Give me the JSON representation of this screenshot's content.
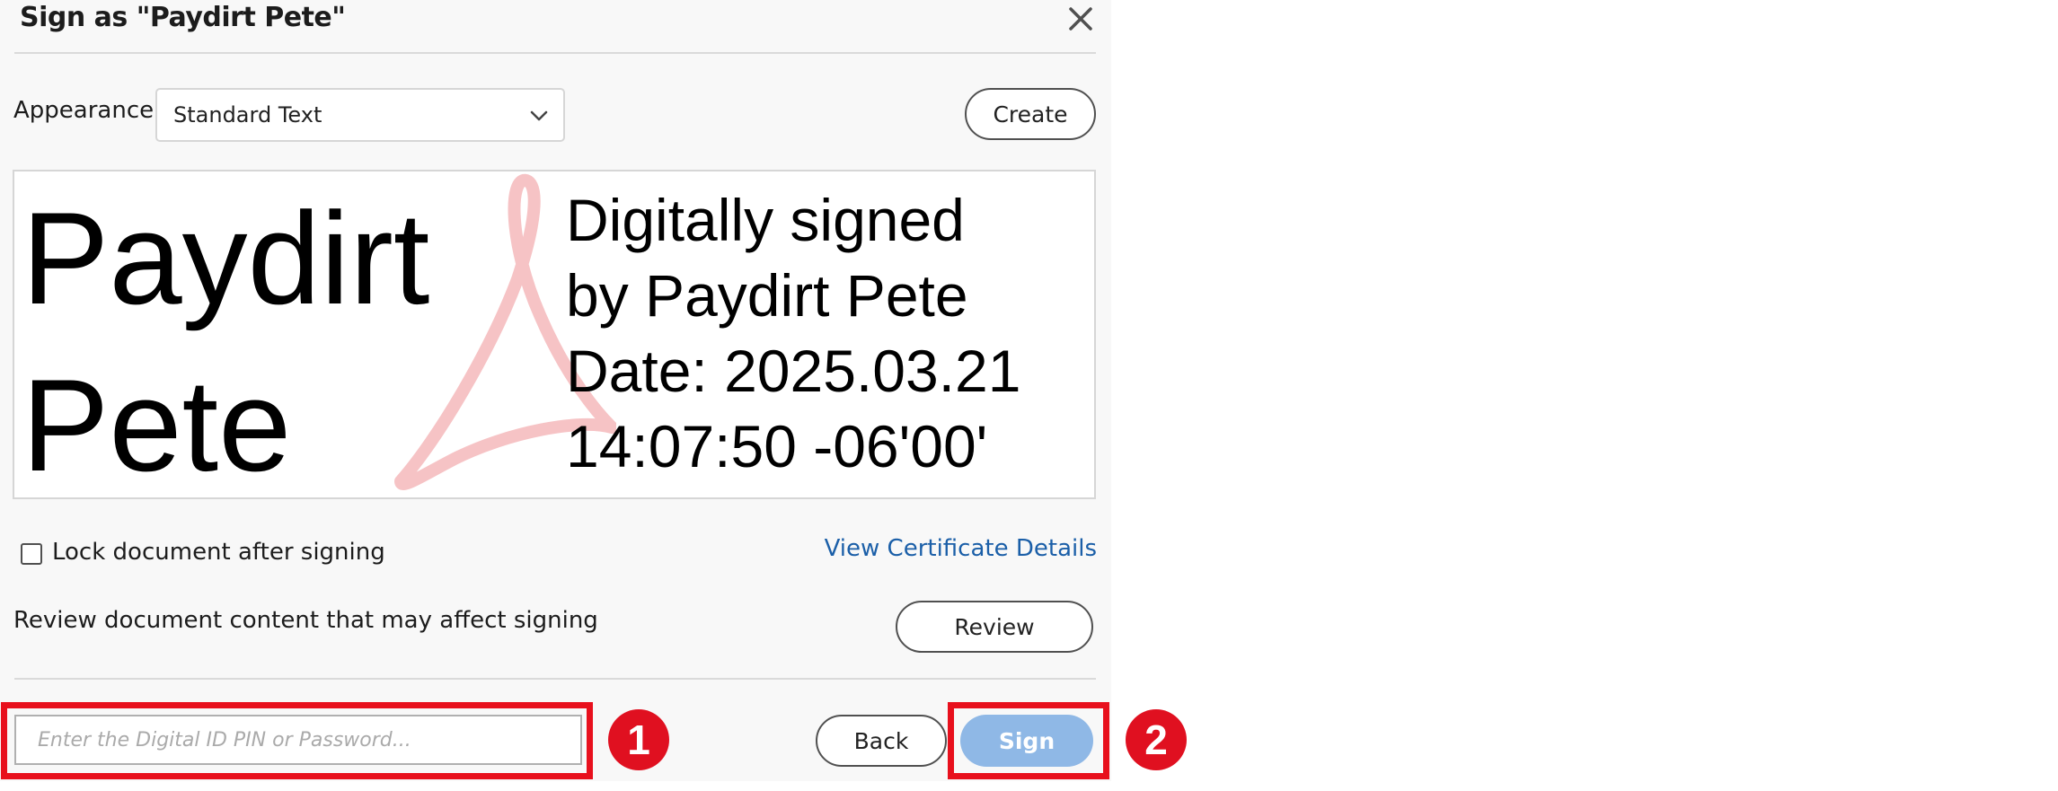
{
  "dialog": {
    "title": "Sign as \"Paydirt Pete\"",
    "close_icon": "close-icon"
  },
  "appearance": {
    "label": "Appearance",
    "selected": "Standard Text",
    "create_label": "Create"
  },
  "preview": {
    "name_lines": [
      "Paydirt",
      "Pete"
    ],
    "detail_lines": [
      "Digitally signed",
      "by Paydirt Pete",
      "Date: 2025.03.21",
      "14:07:50 -06'00'"
    ]
  },
  "options": {
    "lock_label": "Lock document after signing",
    "lock_checked": false,
    "certificate_link": "View Certificate Details",
    "review_text": "Review document content that may affect signing",
    "review_label": "Review"
  },
  "footer": {
    "password_placeholder": "Enter the Digital ID PIN or Password...",
    "back_label": "Back",
    "sign_label": "Sign"
  },
  "callouts": [
    "1",
    "2"
  ],
  "colors": {
    "callout_red": "#e8101d",
    "link_blue": "#1b5fa8",
    "sign_button": "#8fb8e6"
  }
}
